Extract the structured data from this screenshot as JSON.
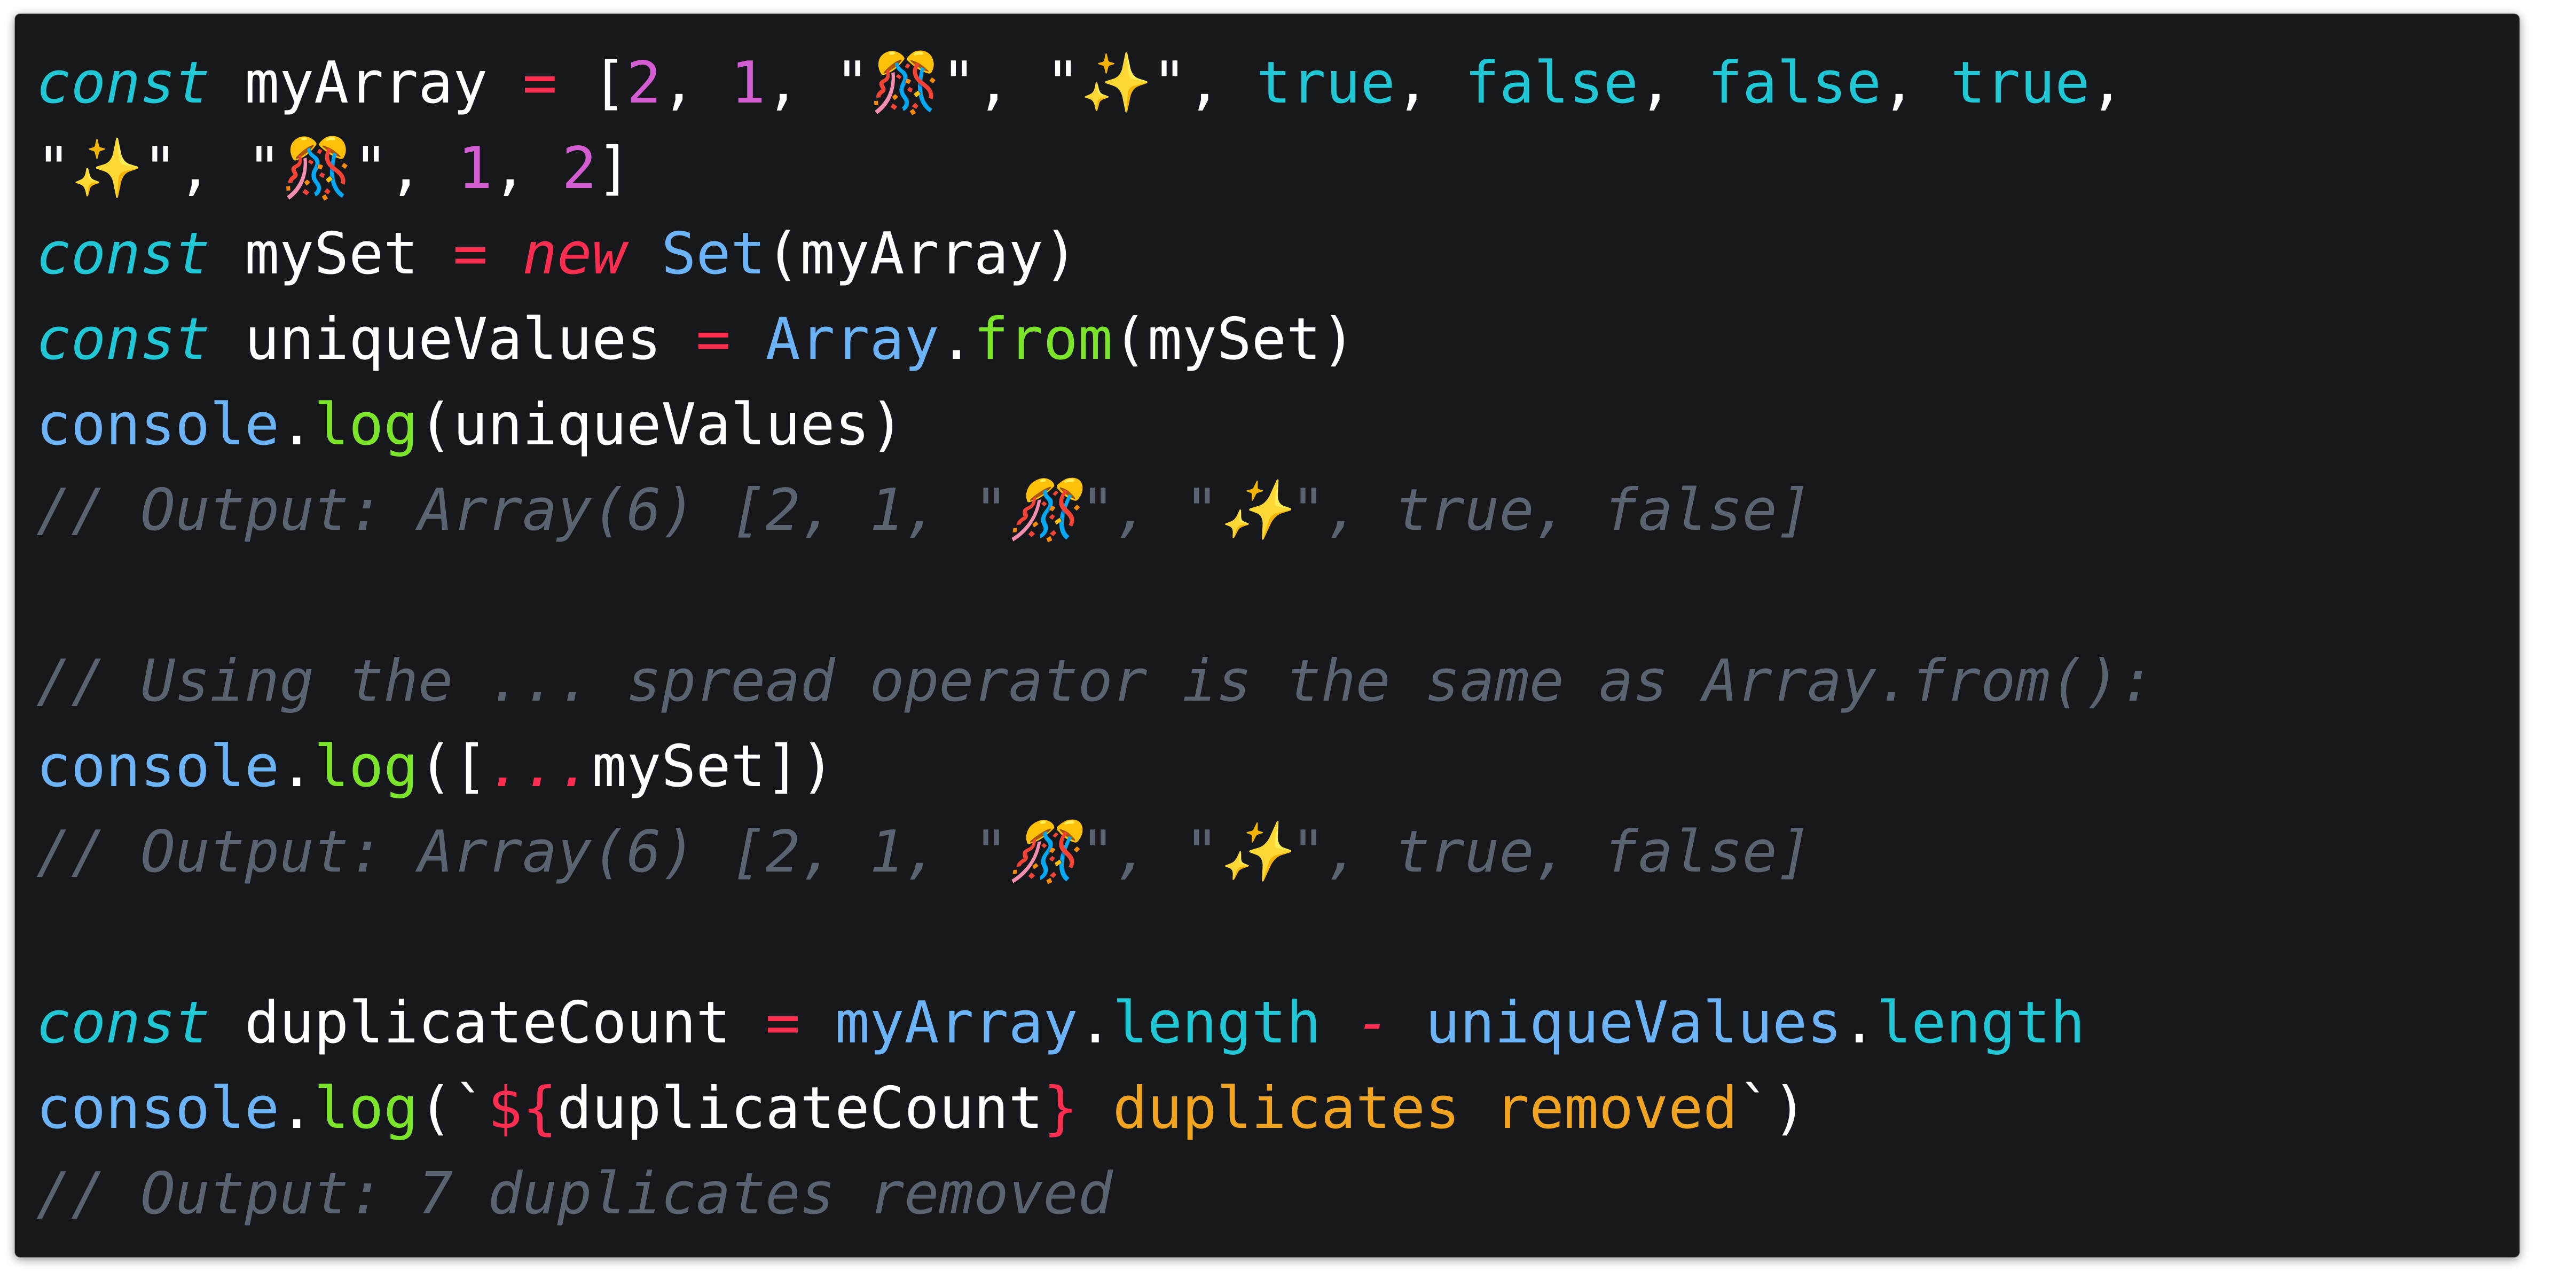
{
  "editor": {
    "lines": [
      [
        {
          "t": "const",
          "c": "kw"
        },
        {
          "t": " myArray ",
          "c": "plain"
        },
        {
          "t": "=",
          "c": "op"
        },
        {
          "t": " [",
          "c": "plain"
        },
        {
          "t": "2",
          "c": "num"
        },
        {
          "t": ", ",
          "c": "plain"
        },
        {
          "t": "1",
          "c": "num"
        },
        {
          "t": ", \"🎊\", \"✨\", ",
          "c": "plain"
        },
        {
          "t": "true",
          "c": "bool"
        },
        {
          "t": ", ",
          "c": "plain"
        },
        {
          "t": "false",
          "c": "bool"
        },
        {
          "t": ", ",
          "c": "plain"
        },
        {
          "t": "false",
          "c": "bool"
        },
        {
          "t": ", ",
          "c": "plain"
        },
        {
          "t": "true",
          "c": "bool"
        },
        {
          "t": ",",
          "c": "plain"
        }
      ],
      [
        {
          "t": "\"✨\", \"🎊\", ",
          "c": "plain"
        },
        {
          "t": "1",
          "c": "num"
        },
        {
          "t": ", ",
          "c": "plain"
        },
        {
          "t": "2",
          "c": "num"
        },
        {
          "t": "]",
          "c": "plain"
        }
      ],
      [
        {
          "t": "const",
          "c": "kw"
        },
        {
          "t": " mySet ",
          "c": "plain"
        },
        {
          "t": "=",
          "c": "op"
        },
        {
          "t": " ",
          "c": "plain"
        },
        {
          "t": "new",
          "c": "new"
        },
        {
          "t": " ",
          "c": "plain"
        },
        {
          "t": "Set",
          "c": "cls"
        },
        {
          "t": "(myArray)",
          "c": "plain"
        }
      ],
      [
        {
          "t": "const",
          "c": "kw"
        },
        {
          "t": " uniqueValues ",
          "c": "plain"
        },
        {
          "t": "=",
          "c": "op"
        },
        {
          "t": " ",
          "c": "plain"
        },
        {
          "t": "Array",
          "c": "cls"
        },
        {
          "t": ".",
          "c": "plain"
        },
        {
          "t": "from",
          "c": "fn"
        },
        {
          "t": "(mySet)",
          "c": "plain"
        }
      ],
      [
        {
          "t": "console",
          "c": "cls"
        },
        {
          "t": ".",
          "c": "plain"
        },
        {
          "t": "log",
          "c": "fn"
        },
        {
          "t": "(uniqueValues)",
          "c": "plain"
        }
      ],
      [
        {
          "t": "// Output: Array(6) [2, 1, \"🎊\", \"✨\", true, false]",
          "c": "cmt"
        }
      ],
      [],
      [
        {
          "t": "// Using the ... spread operator is the same as Array.from():",
          "c": "cmt"
        }
      ],
      [
        {
          "t": "console",
          "c": "cls"
        },
        {
          "t": ".",
          "c": "plain"
        },
        {
          "t": "log",
          "c": "fn"
        },
        {
          "t": "([",
          "c": "plain"
        },
        {
          "t": "...",
          "c": "op"
        },
        {
          "t": "mySet])",
          "c": "plain"
        }
      ],
      [
        {
          "t": "// Output: Array(6) [2, 1, \"🎊\", \"✨\", true, false]",
          "c": "cmt"
        }
      ],
      [],
      [
        {
          "t": "const",
          "c": "kw"
        },
        {
          "t": " duplicateCount ",
          "c": "plain"
        },
        {
          "t": "=",
          "c": "op"
        },
        {
          "t": " ",
          "c": "plain"
        },
        {
          "t": "myArray",
          "c": "cls"
        },
        {
          "t": ".",
          "c": "plain"
        },
        {
          "t": "length",
          "c": "prop"
        },
        {
          "t": " ",
          "c": "plain"
        },
        {
          "t": "-",
          "c": "op"
        },
        {
          "t": " ",
          "c": "plain"
        },
        {
          "t": "uniqueValues",
          "c": "cls"
        },
        {
          "t": ".",
          "c": "plain"
        },
        {
          "t": "length",
          "c": "prop"
        }
      ],
      [
        {
          "t": "console",
          "c": "cls"
        },
        {
          "t": ".",
          "c": "plain"
        },
        {
          "t": "log",
          "c": "fn"
        },
        {
          "t": "(`",
          "c": "plain"
        },
        {
          "t": "${",
          "c": "tpl"
        },
        {
          "t": "duplicateCount",
          "c": "plain"
        },
        {
          "t": "}",
          "c": "tpl"
        },
        {
          "t": " duplicates removed",
          "c": "str"
        },
        {
          "t": "`)",
          "c": "plain"
        }
      ],
      [
        {
          "t": "// Output: 7 duplicates removed",
          "c": "cmt"
        }
      ]
    ]
  }
}
